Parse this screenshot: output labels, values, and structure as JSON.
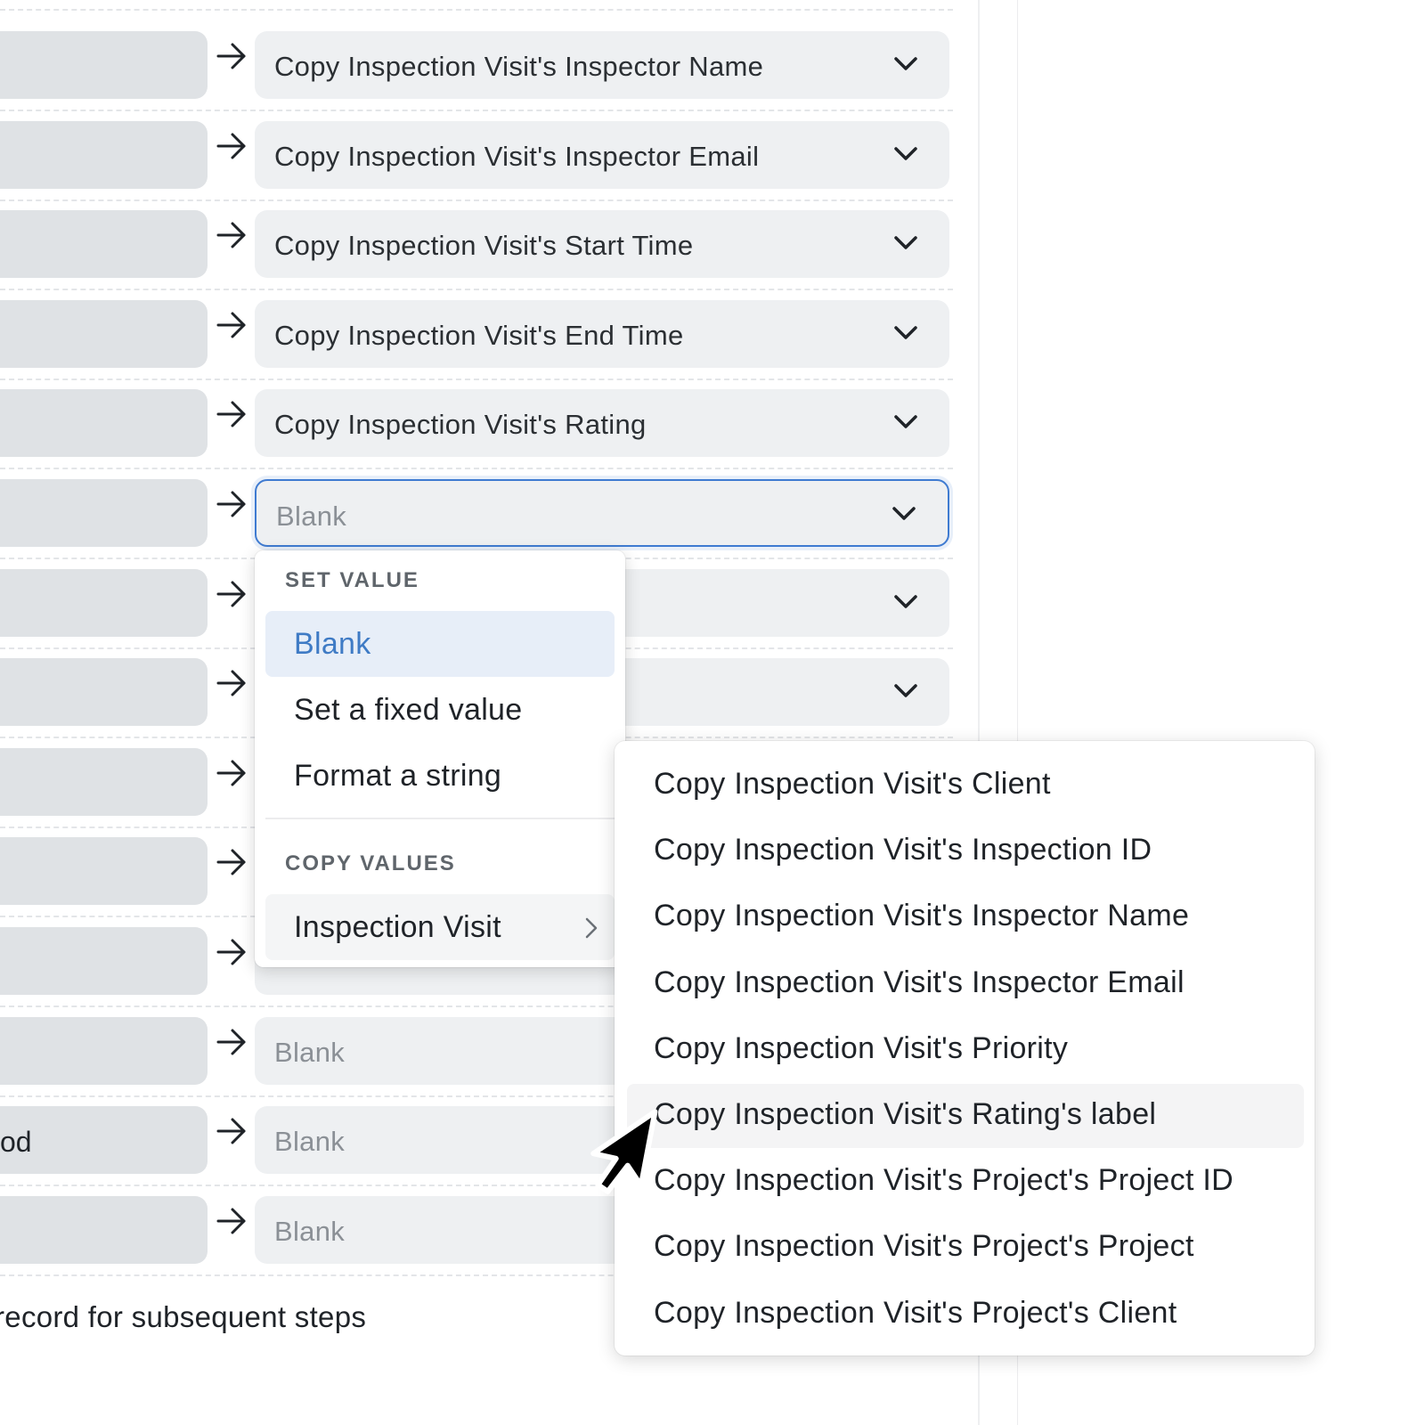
{
  "rows": [
    {
      "source": "",
      "target": "Copy Inspection Visit's Inspector Name",
      "placeholder": false
    },
    {
      "source": "",
      "target": "Copy Inspection Visit's Inspector Email",
      "placeholder": false
    },
    {
      "source": "",
      "target": "Copy Inspection Visit's Start Time",
      "placeholder": false
    },
    {
      "source": "",
      "target": "Copy Inspection Visit's End Time",
      "placeholder": false
    },
    {
      "source": "",
      "target": "Copy Inspection Visit's Rating",
      "placeholder": false
    },
    {
      "source": "",
      "target": "Blank",
      "placeholder": true,
      "active": true
    },
    {
      "source": "",
      "target": "",
      "placeholder": false
    },
    {
      "source": "",
      "target": "",
      "placeholder": false
    },
    {
      "source": "",
      "target": "",
      "placeholder": false
    },
    {
      "source": "",
      "target": "",
      "placeholder": false
    },
    {
      "source": "",
      "target": "",
      "placeholder": true
    },
    {
      "source": "",
      "target": "Blank",
      "placeholder": true
    },
    {
      "source": "od",
      "target": "Blank",
      "placeholder": true
    },
    {
      "source": "",
      "target": "Blank",
      "placeholder": true
    }
  ],
  "footer_text": "record for subsequent steps",
  "value_menu": {
    "set_value_header": "SET VALUE",
    "blank": "Blank",
    "fixed": "Set a fixed value",
    "format": "Format a string",
    "copy_values_header": "COPY VALUES",
    "inspection_visit": "Inspection Visit"
  },
  "submenu": [
    "Copy Inspection Visit's Client",
    "Copy Inspection Visit's Inspection ID",
    "Copy Inspection Visit's Inspector Name",
    "Copy Inspection Visit's Inspector Email",
    "Copy Inspection Visit's Priority",
    "Copy Inspection Visit's Rating's label",
    "Copy Inspection Visit's Project's Project ID",
    "Copy Inspection Visit's Project's Project",
    "Copy Inspection Visit's Project's Client"
  ],
  "colors": {
    "accent": "#3f7bd1",
    "selected_bg": "#e7eef8"
  }
}
